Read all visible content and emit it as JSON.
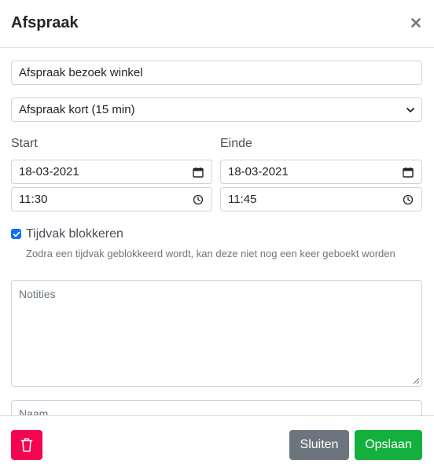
{
  "modal": {
    "title": "Afspraak",
    "close_icon": "close-icon"
  },
  "form": {
    "subject_value": "Afspraak bezoek winkel",
    "type_selected": "Afspraak kort (15 min)",
    "start_label": "Start",
    "end_label": "Einde",
    "start_date": "18-03-2021",
    "end_date": "18-03-2021",
    "start_time": "11:30",
    "end_time": "11:45",
    "block_checked": true,
    "block_label": "Tijdvak blokkeren",
    "block_help": "Zodra een tijdvak geblokkeerd wordt, kan deze niet nog een keer geboekt worden",
    "notes_placeholder": "Notities",
    "name_placeholder": "Naam"
  },
  "footer": {
    "delete_icon": "trash-icon",
    "close_label": "Sluiten",
    "save_label": "Opslaan"
  },
  "colors": {
    "delete": "#f5044f",
    "close": "#6c757d",
    "save": "#14b03d",
    "checkbox": "#0d6efd"
  }
}
